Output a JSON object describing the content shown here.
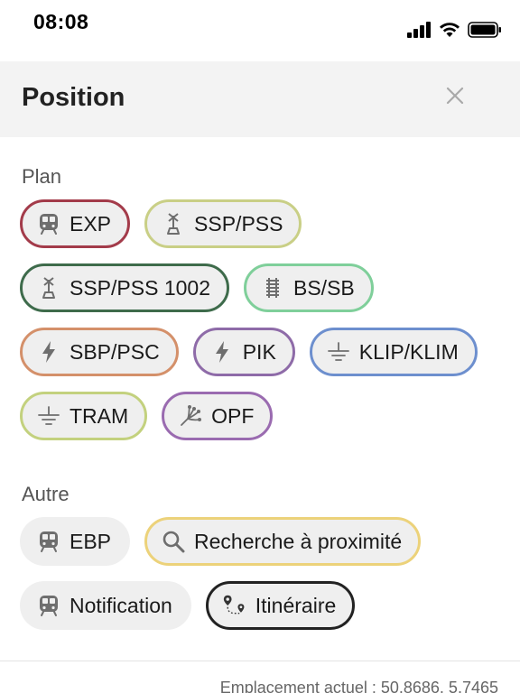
{
  "status": {
    "time": "08:08"
  },
  "header": {
    "title": "Position"
  },
  "sections": {
    "plan": {
      "title": "Plan",
      "rows": [
        [
          {
            "label": "EXP",
            "icon": "train-icon",
            "border": "#a33b4a"
          },
          {
            "label": "SSP/PSS",
            "icon": "substation-icon",
            "border": "#c9cf86"
          }
        ],
        [
          {
            "label": "SSP/PSS 1002",
            "icon": "substation-icon",
            "border": "#3e6b4b"
          },
          {
            "label": "BS/SB",
            "icon": "track-icon",
            "border": "#7fcf9a"
          }
        ],
        [
          {
            "label": "SBP/PSC",
            "icon": "lightning-icon",
            "border": "#d4906a"
          },
          {
            "label": "PIK",
            "icon": "lightning-icon",
            "border": "#8e6ba8"
          },
          {
            "label": "KLIP/KLIM",
            "icon": "ground-icon",
            "border": "#6d8fce"
          }
        ],
        [
          {
            "label": "TRAM",
            "icon": "ground-icon",
            "border": "#c3d17e"
          },
          {
            "label": "OPF",
            "icon": "fiber-icon",
            "border": "#9a6bb0"
          }
        ]
      ]
    },
    "autre": {
      "title": "Autre",
      "rows": [
        [
          {
            "label": "EBP",
            "icon": "train-icon",
            "border": "transparent"
          },
          {
            "label": "Recherche à proximité",
            "icon": "search-icon",
            "border": "#ecd27a"
          }
        ],
        [
          {
            "label": "Notification",
            "icon": "train-icon",
            "border": "transparent"
          },
          {
            "label": "Itinéraire",
            "icon": "route-icon",
            "border": "#222222"
          }
        ]
      ]
    }
  },
  "footer": {
    "text": "Emplacement actuel : 50.8686, 5.7465"
  }
}
